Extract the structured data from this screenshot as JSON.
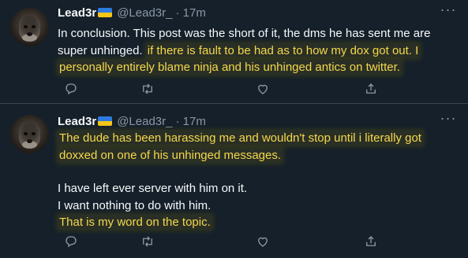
{
  "tweets": [
    {
      "display_name": "Lead3r",
      "handle": "@Lead3r_",
      "time": "· 17m",
      "more": "···",
      "segments": [
        {
          "text": "In conclusion. This post was the short of it, the dms he has sent me are",
          "highlight": false
        },
        {
          "text": "super unhinged. ",
          "highlight": false
        },
        {
          "text": "if there is fault to be had as to how my dox got out. I",
          "highlight": true
        },
        {
          "text": "personally entirely blame ninja and his unhinged antics on twitter.",
          "highlight": true
        }
      ]
    },
    {
      "display_name": "Lead3r",
      "handle": "@Lead3r_",
      "time": "· 17m",
      "more": "···",
      "segments": [
        {
          "text": "The dude has been harassing me and wouldn't stop until i literally got",
          "highlight": true
        },
        {
          "text": "doxxed on one of his unhinged messages.",
          "highlight": true
        },
        {
          "text": "I have left ever server with him on it.",
          "highlight": false
        },
        {
          "text": "I want nothing to do with him.",
          "highlight": false
        },
        {
          "text": "That is my word on the topic.",
          "highlight": true
        }
      ]
    }
  ],
  "icons": [
    "reply-icon",
    "retweet-icon",
    "like-icon",
    "share-icon",
    "more-icon",
    "ukraine-flag-icon"
  ],
  "colors": {
    "background": "#15202b",
    "text": "#f7f9f9",
    "secondary": "#8b98a5",
    "highlight_text": "#f4d84a",
    "divider": "#38444d"
  }
}
